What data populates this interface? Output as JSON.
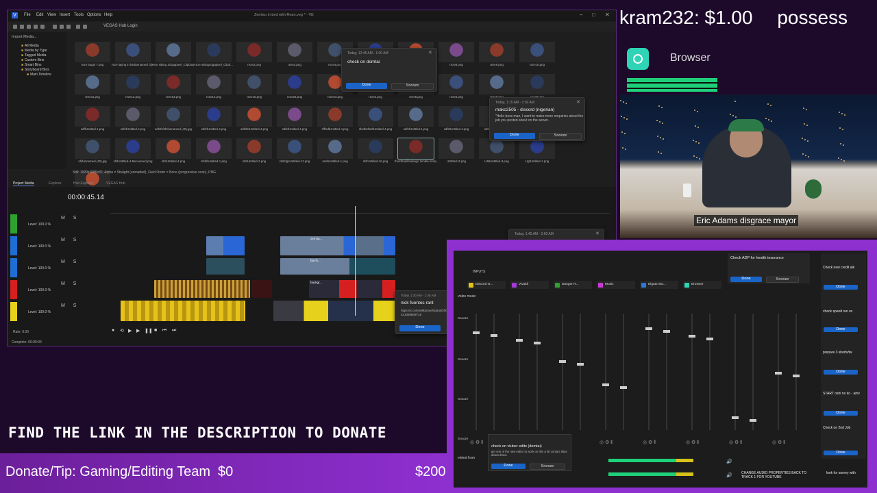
{
  "vegas": {
    "title": "Zenitsu in bed with Rean.veg * - VE",
    "menu": [
      "File",
      "Edit",
      "View",
      "Insert",
      "Tools",
      "Options",
      "Help"
    ],
    "hub_login": "VEGAS Hub Login",
    "tree": {
      "header": "Import Media...",
      "items": [
        "All Media",
        "Media by Type",
        "Tagged Media",
        "Custom Bins",
        "Smart Bins",
        "Storyboard Bins",
        "Main Timeline"
      ]
    },
    "media_labels": [
      "reze laugh 7.png",
      "reze laying in bedunnamed (4)-...",
      "reze sitting 2Gigapixel_Clipboard_...",
      "reze sittingGigapixel_Clipb...",
      "reze2.png",
      "reze3.png",
      "reze4.png",
      "reze6.png",
      "reze7.png",
      "reze8.png",
      "reze9.png",
      "reze10.png",
      "reze11.png",
      "reze12.png",
      "reze13.png",
      "reze14.png",
      "reze15.png",
      "reze22.png",
      "reze23.png",
      "reze4.png",
      "reze5.png",
      "reze6.png",
      "reze8.png",
      "reze9.png",
      "sdffUntitled-1.png",
      "sdfsfUntitled-4.png",
      "sdfsfsfsfsfunnamed (45).jpg",
      "sdfsfUntitled-4.png",
      "sdfsfsfUntitled-4.png",
      "sdfsfUntitled-4.png",
      "sfffsdfUntitled-4.png",
      "sfsdfsdfsdfUntitled-4.png",
      "sdfsfUntitled-1.png",
      "sdfsfUntitled-4.png",
      "sdfsfUntitled-4.png",
      "sfsdfUntitled-4.png",
      "sfsfunnamed (40).jpg",
      "sfsfUntitled-4-Recovered.png",
      "sfsfUntitled-4.png",
      "sfsfsfUntitled-1.png",
      "sfsfUntitled-2.png",
      "sfsfsfgsUntitled-12.png",
      "sssfsUntitled-1.png",
      "sfsfUntitled-16.png",
      "thumbnail kaisugo zenitsu reze.png",
      "UStitled-3.png",
      "U66Untitled-3.png",
      "UgfUntitled-1.png",
      "UntiUntitled-3.png"
    ],
    "still_info": "Still: 1920x1080x32, Alpha = Straight (unmatted), Field Order = None (progressive scan), PNG",
    "tabs": [
      "Project Media",
      "Explorer",
      "Hub Explorer",
      "VEGAS Hub"
    ],
    "timecode": "00:00:45.14",
    "tracks": [
      {
        "level": "Level: 100.0 %",
        "color": "#2ea12e"
      },
      {
        "level": "Level: 100.0 %",
        "color": "#1e6ed6"
      },
      {
        "level": "Level: 100.0 %",
        "color": "#1e6ed6"
      },
      {
        "level": "Level: 100.0 %",
        "color": "#d62020"
      },
      {
        "level": "Level: 100.0 %",
        "color": "#e6d21a"
      }
    ],
    "track_buttons": "M S",
    "clip_labels": [
      "zen ba...",
      "bat fx...",
      "backgr...",
      "fx",
      "fx"
    ],
    "rate": "Rate: 0.00",
    "complete": "Complete: 00:00:00"
  },
  "notifications": [
    {
      "date": "Today, 12:45 AM - 1:00 AM",
      "title": "check on domtai",
      "body": "",
      "done": "Done",
      "snooze": "Snooze"
    },
    {
      "date": "Today, 1:15 AM - 1:30 AM",
      "title": "mako2505 - discord (nigerian)",
      "body": "\"Hello boss man, I want to make more enquiries about the job you posted about on the server.",
      "done": "Done",
      "snooze": "Snooze"
    },
    {
      "date": "Today, 1:30 AM - 1:45 AM",
      "title": "nick fuentes rant",
      "body": "https://x.com/milkymoe/status/2006441089809719",
      "done": "Done"
    },
    {
      "date": "Today, 1:45 AM - 2:00 AM",
      "title": "",
      "body": ""
    }
  ],
  "stream": {
    "donation_user": "kram232:",
    "donation_amount": "$1.00",
    "donation_tail": "possess",
    "browser_label": "Browser",
    "caption": "Eric Adams disgrace mayor",
    "find_link": "FIND THE LINK IN THE DESCRIPTION TO DONATE",
    "donate_label": "Donate/Tip: Gaming/Editing Team",
    "donate_current": "$0",
    "donate_goal": "$200"
  },
  "mixer": {
    "inputs_label": "INPUTS",
    "channels": [
      {
        "name": "Discord O...",
        "color": "#e6c31a",
        "fader": 0.85
      },
      {
        "name": "Vivaldi",
        "color": "#a23ad6",
        "fader": 0.78
      },
      {
        "name": "Danger R...",
        "color": "#2ea12e",
        "fader": 0.6
      },
      {
        "name": "Music",
        "color": "#c83ad6",
        "fader": 0.4
      },
      {
        "name": "Elgato Wa...",
        "color": "#2a7ad6",
        "fader": 0.88
      },
      {
        "name": "Browser",
        "color": "#2fd3b5",
        "fader": 0.82
      },
      {
        "name": "",
        "color": "#333333",
        "fader": 0.12
      },
      {
        "name": "",
        "color": "#333333",
        "fader": 0.5
      }
    ],
    "side_tasks": [
      {
        "title": "Check ADP for health insurance",
        "done": "Done",
        "snooze": "Snooze"
      },
      {
        "title": "Check new credit alk"
      },
      {
        "title": "check speed run ex"
      },
      {
        "title": "prepare 3 shorts/tw"
      },
      {
        "title": "START oshi no ko - amv"
      },
      {
        "title": "Check on 2nd Job"
      },
      {
        "title": "look for survey with"
      }
    ],
    "bottom_task": {
      "title": "check on vtuber edits (domtai)",
      "body": "get one of the new editor to work on this a bit contact Ikias about dmca",
      "done": "Done",
      "snooze": "Snooze"
    },
    "footer_task": "CHANGE AUDIO PROPERTIES BACK TO TRACK 1 FOR YOUTUBE",
    "left_labels": [
      "vtube music",
      "Snooze",
      "Snooze",
      "Snooze",
      "Snooze",
      "eleted from"
    ]
  }
}
